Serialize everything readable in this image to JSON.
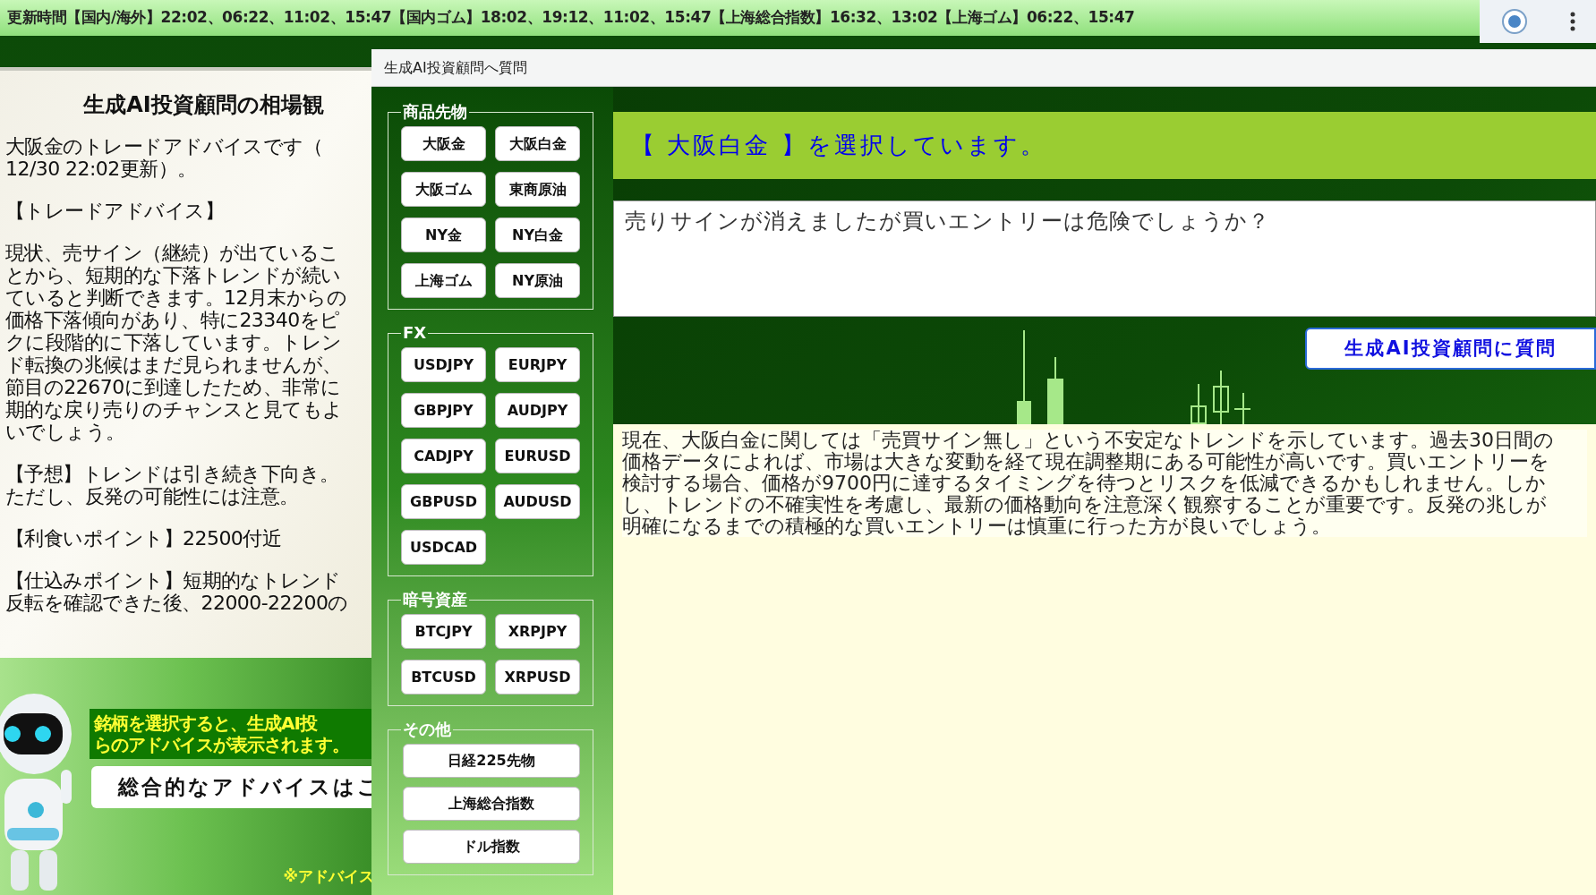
{
  "ticker": "更新時間【国内/海外】22:02、06:22、11:02、15:47【国内ゴム】18:02、19:12、11:02、15:47【上海総合指数】16:32、13:02【上海ゴム】06:22、15:47",
  "left_panel": {
    "title": "生成AI投資顧問の相場観",
    "paragraphs": [
      [
        "大阪金のトレードアドバイスです（",
        "12/30 22:02更新）。"
      ],
      [
        "【トレードアドバイス】"
      ],
      [
        "現状、売サイン（継続）が出ているこ",
        "とから、短期的な下落トレンドが続い",
        "ていると判断できます。12月末からの",
        "価格下落傾向があり、特に23340をピ",
        "クに段階的に下落しています。トレン",
        "ド転換の兆候はまだ見られませんが、",
        "節目の22670に到達したため、非常に",
        "期的な戻り売りのチャンスと見てもよ",
        "いでしょう。"
      ],
      [
        "【予想】トレンドは引き続き下向き。",
        "ただし、反発の可能性には注意。"
      ],
      [
        "【利食いポイント】22500付近"
      ],
      [
        "【仕込みポイント】短期的なトレンド",
        "反転を確認できた後、22000-22200の"
      ]
    ]
  },
  "promo": {
    "notice": [
      "銘柄を選択すると、生成AI投",
      "らのアドバイスが表示されます。"
    ],
    "button": "総合的なアドバイスはこ",
    "footnote": "※アドバイス"
  },
  "dialog": {
    "title": "生成AI投資顧問へ質問",
    "groups": [
      {
        "label": "商品先物",
        "kind": "grid",
        "buttons": [
          "大阪金",
          "大阪白金",
          "大阪ゴム",
          "東商原油",
          "NY金",
          "NY白金",
          "上海ゴム",
          "NY原油"
        ]
      },
      {
        "label": "FX",
        "kind": "grid",
        "buttons": [
          "USDJPY",
          "EURJPY",
          "GBPJPY",
          "AUDJPY",
          "CADJPY",
          "EURUSD",
          "GBPUSD",
          "AUDUSD",
          "USDCAD"
        ]
      },
      {
        "label": "暗号資産",
        "kind": "grid",
        "buttons": [
          "BTCJPY",
          "XRPJPY",
          "BTCUSD",
          "XRPUSD"
        ]
      },
      {
        "label": "その他",
        "kind": "list",
        "buttons": [
          "日経225先物",
          "上海総合指数",
          "ドル指数"
        ]
      }
    ],
    "selection": "【 大阪白金 】を選択しています。",
    "question": "売りサインが消えましたが買いエントリーは危険でしょうか？",
    "ask_button": "生成AI投資顧問に質問",
    "answer": "現在、大阪白金に関しては「売買サイン無し」という不安定なトレンドを示しています。過去30日間の価格データによれば、市場は大きな変動を経て現在調整期にある可能性が高いです。買いエントリーを検討する場合、価格が9700円に達するタイミングを待つとリスクを低減できるかもしれません。しかし、トレンドの不確実性を考慮し、最新の価格動向を注意深く観察することが重要です。反発の兆しが明確になるまでの積極的な買いエントリーは慎重に行った方が良いでしょう。"
  }
}
